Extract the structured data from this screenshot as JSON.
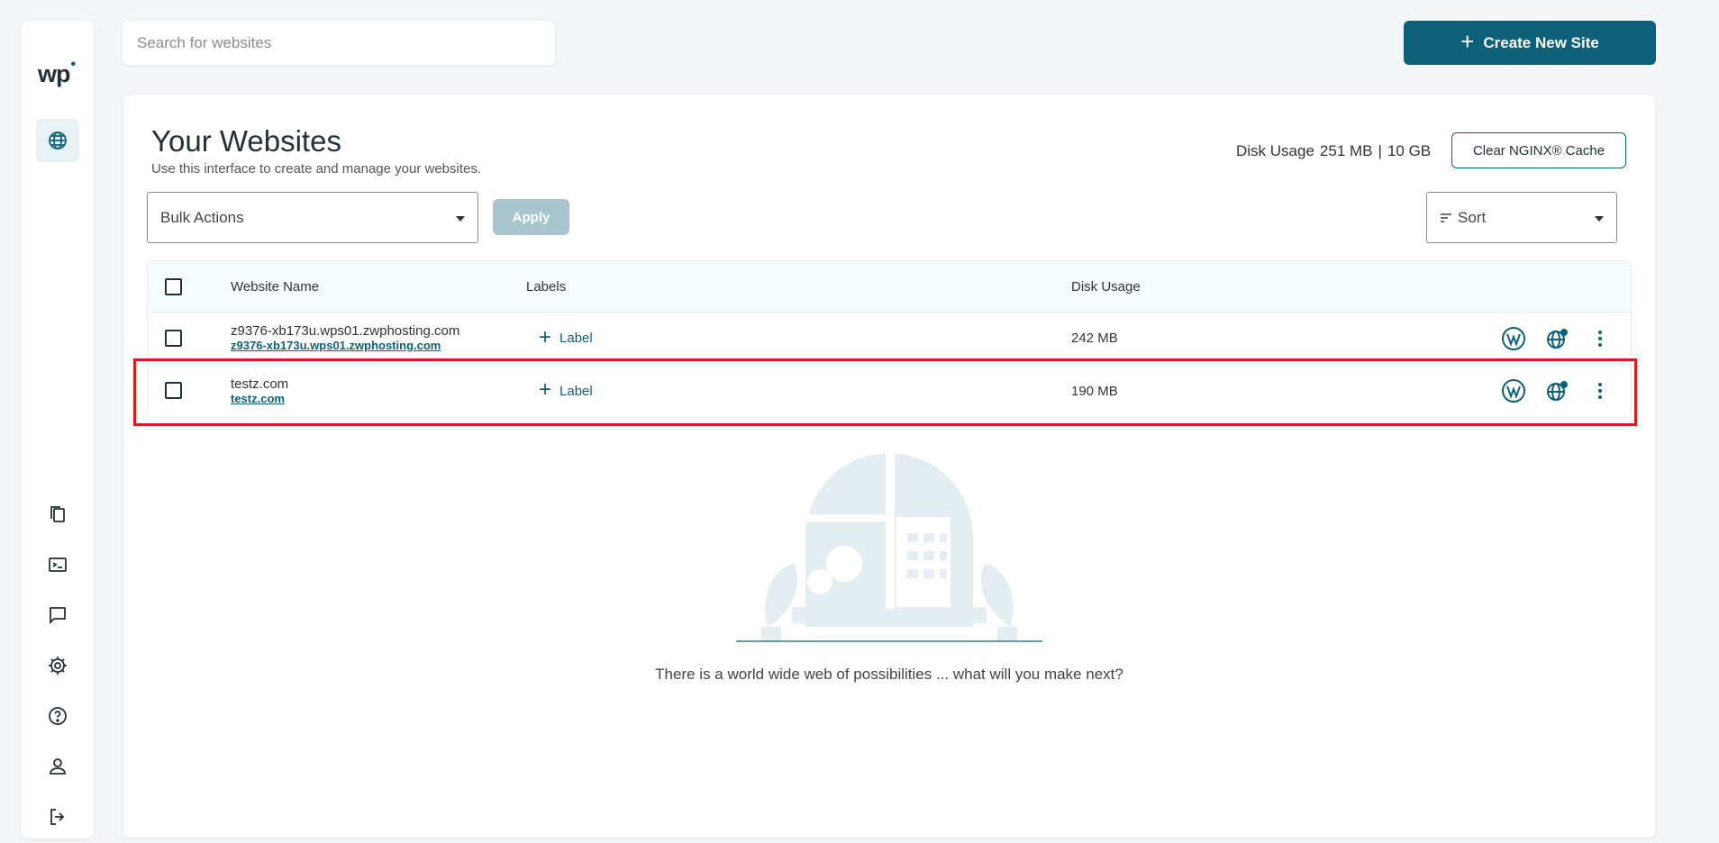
{
  "sidebar": {
    "logo": "wp",
    "logo_dot": "•"
  },
  "search": {
    "placeholder": "Search for websites"
  },
  "create_button": {
    "label": "Create New Site",
    "plus": "+"
  },
  "main": {
    "title": "Your Websites",
    "subtitle": "Use this interface to create and manage your websites.",
    "disk_usage_label": "Disk Usage",
    "disk_used": "251 MB",
    "disk_separator": "|",
    "disk_total": "10 GB",
    "clear_cache_label": "Clear NGINX® Cache",
    "bulk_actions_label": "Bulk Actions",
    "apply_label": "Apply",
    "sort_label": "Sort"
  },
  "table": {
    "headers": {
      "name": "Website Name",
      "labels": "Labels",
      "disk": "Disk Usage"
    },
    "rows": [
      {
        "name": "z9376-xb173u.wps01.zwphosting.com",
        "link": "z9376-xb173u.wps01.zwphosting.com",
        "label_btn": "Label",
        "disk": "242 MB"
      },
      {
        "name": "testz.com",
        "link": "testz.com",
        "label_btn": "Label",
        "disk": "190 MB"
      }
    ]
  },
  "empty_state": {
    "text": "There is a world wide web of possibilities ... what will you make next?"
  },
  "colors": {
    "primary": "#0d6079",
    "highlight": "#e0191e",
    "apply_disabled": "#a7c4cf"
  }
}
